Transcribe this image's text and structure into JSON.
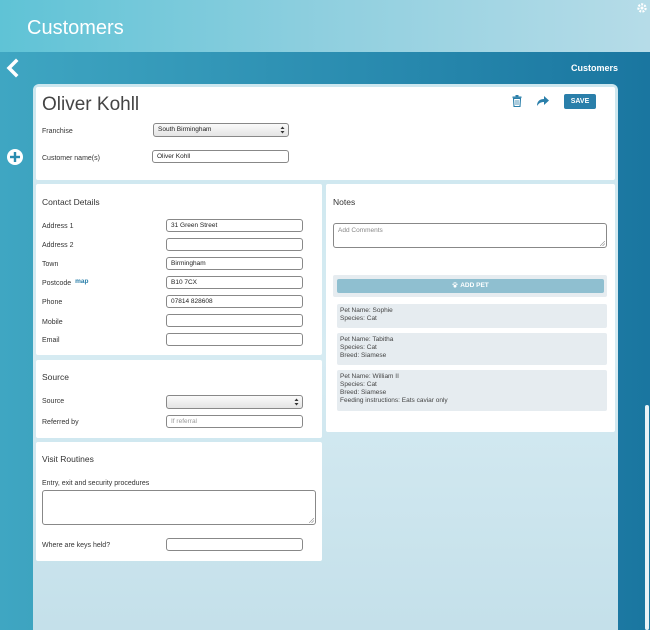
{
  "app": {
    "title": "Customers"
  },
  "breadcrumb": "Customers",
  "customer": {
    "name": "Oliver Kohll",
    "franchise_label": "Franchise",
    "franchise_value": "South Birmingham",
    "customer_name_label": "Customer name(s)",
    "customer_name_value": "Oliver Kohll",
    "save_label": "SAVE"
  },
  "contact": {
    "title": "Contact Details",
    "fields": [
      {
        "label": "Address 1",
        "value": "31 Green Street"
      },
      {
        "label": "Address 2",
        "value": ""
      },
      {
        "label": "Town",
        "value": "Birmingham"
      },
      {
        "label": "Postcode",
        "value": "B10 7CX",
        "link": "map"
      },
      {
        "label": "Phone",
        "value": "07814 828608"
      },
      {
        "label": "Mobile",
        "value": ""
      },
      {
        "label": "Email",
        "value": ""
      }
    ]
  },
  "source": {
    "title": "Source",
    "source_label": "Source",
    "source_value": "",
    "referred_label": "Referred by",
    "referred_placeholder": "If referral"
  },
  "visit": {
    "title": "Visit Routines",
    "entry_label": "Entry, exit and security procedures",
    "entry_value": "",
    "keys_label": "Where are keys held?",
    "keys_value": ""
  },
  "notes": {
    "title": "Notes",
    "placeholder": "Add Comments",
    "add_pet_label": "ADD PET"
  },
  "pets": [
    {
      "lines": [
        {
          "key": "Pet Name:",
          "value": "Sophie"
        },
        {
          "key": "Species:",
          "value": "Cat"
        }
      ]
    },
    {
      "lines": [
        {
          "key": "Pet Name:",
          "value": "Tabitha"
        },
        {
          "key": "Species:",
          "value": "Cat"
        },
        {
          "key": "Breed:",
          "value": "Siamese"
        }
      ]
    },
    {
      "lines": [
        {
          "key": "Pet Name:",
          "value": "William II"
        },
        {
          "key": "Species:",
          "value": "Cat"
        },
        {
          "key": "Breed:",
          "value": "Siamese"
        },
        {
          "key": "Feeding instructions:",
          "value": "Eats caviar only"
        }
      ]
    }
  ],
  "colors": {
    "accent": "#2a7faa",
    "add_pet": "#8fbfd0"
  },
  "icons": {
    "settings": "gear-icon",
    "back": "back-chevron-icon",
    "add": "plus-circle-icon",
    "delete": "trash-icon",
    "share": "share-arrow-icon"
  }
}
